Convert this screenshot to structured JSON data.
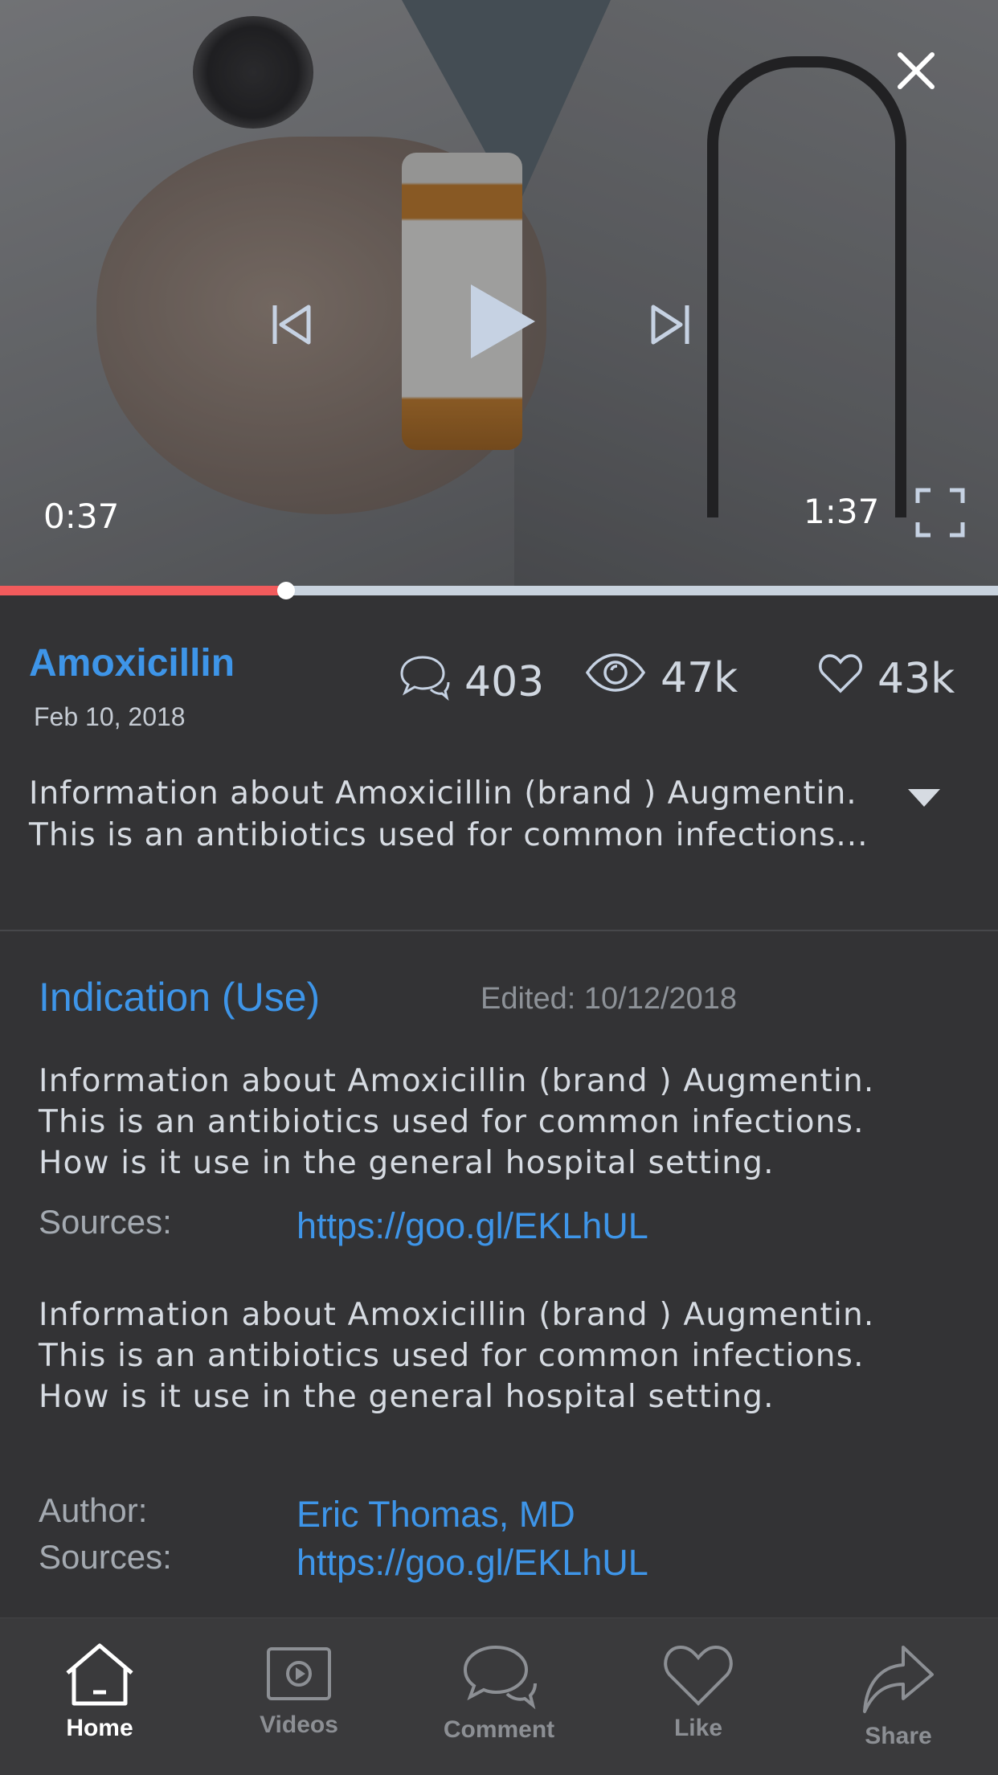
{
  "video": {
    "current_time": "0:37",
    "duration": "1:37",
    "progress": 0.2867
  },
  "post": {
    "title": "Amoxicillin",
    "date": "Feb 10, 2018",
    "stats": {
      "comments": "403",
      "views": "47k",
      "likes": "43k"
    },
    "description_line1": "Information about Amoxicillin (brand ) Augmentin.",
    "description_line2": "This is an antibiotics used for common infections..."
  },
  "section": {
    "title": "Indication (Use)",
    "edited": "Edited: 10/12/2018",
    "paragraph1": [
      "Information about Amoxicillin (brand ) Augmentin.",
      "This is an antibiotics used for common infections.",
      "How is it use in the general hospital setting."
    ],
    "sources_label": "Sources:",
    "source1": "https://goo.gl/EKLhUL",
    "paragraph2": [
      "Information about Amoxicillin (brand ) Augmentin.",
      "This is an antibiotics used for common infections.",
      "How is it use in the general hospital setting."
    ],
    "author_label": "Author:",
    "author": "Eric Thomas, MD",
    "sources_label2": "Sources:",
    "source2": "https://goo.gl/EKLhUL"
  },
  "tabs": [
    {
      "label": "Home",
      "icon": "home-icon",
      "active": true
    },
    {
      "label": "Videos",
      "icon": "video-icon",
      "active": false
    },
    {
      "label": "Comment",
      "icon": "comment-icon",
      "active": false
    },
    {
      "label": "Like",
      "icon": "heart-icon",
      "active": false
    },
    {
      "label": "Share",
      "icon": "share-icon",
      "active": false
    }
  ],
  "colors": {
    "background": "#333335",
    "accent": "#3e95e8",
    "progress_fill": "#f25b5c",
    "tabbar": "#3a3a3c"
  }
}
